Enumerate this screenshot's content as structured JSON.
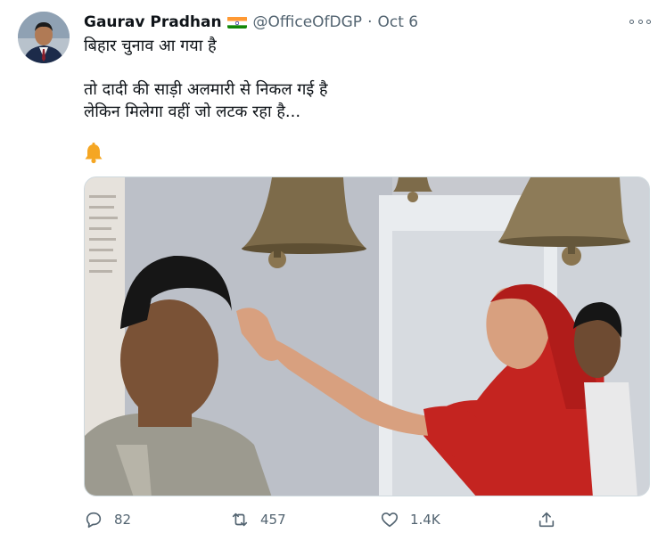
{
  "tweet": {
    "author_name": "Gaurav Pradhan",
    "handle": "@OfficeOfDGP",
    "separator": "·",
    "date": "Oct 6",
    "lines": [
      "बिहार चुनाव आ गया है",
      "तो दादी की साड़ी अलमारी से निकल गई है",
      "लेकिन मिलेगा वहीं जो लटक रहा है..."
    ],
    "emoji": "bell-icon"
  },
  "actions": {
    "reply_count": "82",
    "retweet_count": "457",
    "like_count": "1.4K"
  },
  "colors": {
    "text": "#0f1419",
    "secondary": "#536471",
    "saffron": "#ff9933",
    "green": "#138808"
  }
}
